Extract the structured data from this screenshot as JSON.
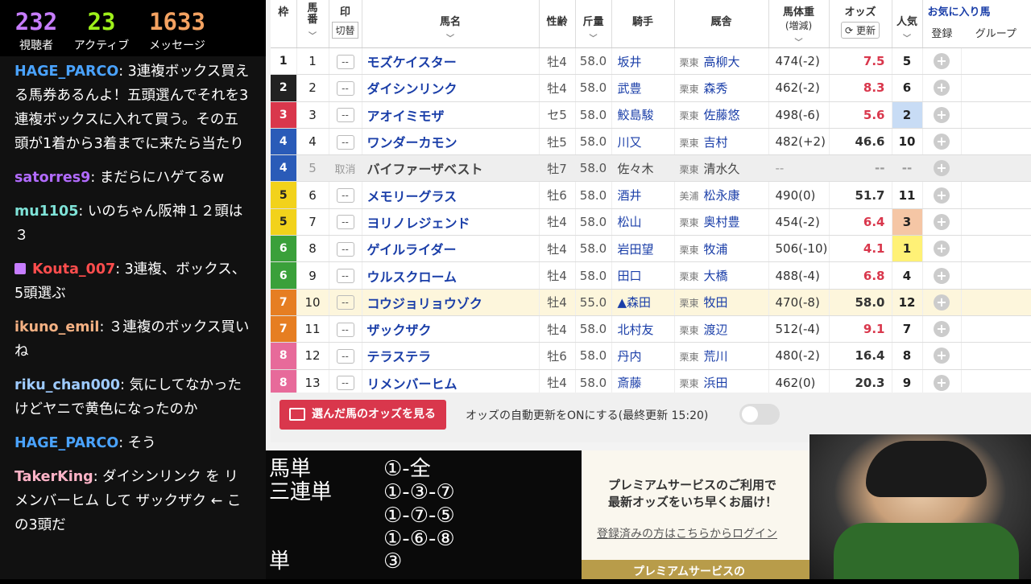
{
  "stats": [
    {
      "value": "232",
      "label": "視聴者",
      "color": "#c77dff"
    },
    {
      "value": "23",
      "label": "アクティブ",
      "color": "#9ef01a"
    },
    {
      "value": "1633",
      "label": "メッセージ",
      "color": "#f4a261"
    }
  ],
  "chat": [
    {
      "user": "HAGE_PARCO",
      "color": "#4aa3ff",
      "text": ": 3連複ボックス買える馬券あるんよ！五頭選んでそれを3連複ボックスに入れて買う。その五頭が1着から3着までに来たら当たり",
      "gift": false
    },
    {
      "user": "satorres9",
      "color": "#b26bff",
      "text": ": まだらにハゲてるw",
      "gift": false
    },
    {
      "user": "mu1105",
      "color": "#7fe3d8",
      "text": ": いのちゃん阪神１２頭は３",
      "gift": false
    },
    {
      "user": "Kouta_007",
      "color": "#ff4d4d",
      "text": ": 3連複、ボックス、5頭選ぶ",
      "gift": true
    },
    {
      "user": "ikuno_emil",
      "color": "#f4b183",
      "text": ": ３連複のボックス買いね",
      "gift": false
    },
    {
      "user": "riku_chan000",
      "color": "#9ecbff",
      "text": ": 気にしてなかったけどヤニで黄色になったのか",
      "gift": false
    },
    {
      "user": "HAGE_PARCO",
      "color": "#4aa3ff",
      "text": ": そう",
      "gift": false
    },
    {
      "user": "TakerKing",
      "color": "#ffb3c7",
      "text": ": ダイシンリンク を リメンバーヒム して ザックザク ← この3頭だ",
      "gift": false
    }
  ],
  "table": {
    "headers": {
      "waku": "枠",
      "umaban": "馬番",
      "mark": "印",
      "mark_btn": "切替",
      "name": "馬名",
      "age": "性齢",
      "kinryo": "斤量",
      "jockey": "騎手",
      "stable": "厩舎",
      "weight": "馬体重",
      "weight_sub": "(増減)",
      "odds": "オッズ",
      "odds_refresh": "更新",
      "ninki": "人気",
      "fav": "お気に入り馬",
      "fav_reg": "登録",
      "fav_group": "グループ"
    },
    "rows": [
      {
        "waku": "1",
        "umaban": "1",
        "mark": "--",
        "name": "モズケイスター",
        "age": "牡4",
        "kinryo": "58.0",
        "jockey": "坂井",
        "loc": "栗東",
        "trainer": "高柳大",
        "weight": "474(-2)",
        "odds": "7.5",
        "ninki": "5",
        "odds_color": "#d9374c",
        "ninki_bg": ""
      },
      {
        "waku": "2",
        "umaban": "2",
        "mark": "--",
        "name": "ダイシンリンク",
        "age": "牡4",
        "kinryo": "58.0",
        "jockey": "武豊",
        "loc": "栗東",
        "trainer": "森秀",
        "weight": "462(-2)",
        "odds": "8.3",
        "ninki": "6",
        "odds_color": "#d9374c",
        "ninki_bg": ""
      },
      {
        "waku": "3",
        "umaban": "3",
        "mark": "--",
        "name": "アオイミモザ",
        "age": "セ5",
        "kinryo": "58.0",
        "jockey": "鮫島駿",
        "loc": "栗東",
        "trainer": "佐藤悠",
        "weight": "498(-6)",
        "odds": "5.6",
        "ninki": "2",
        "odds_color": "#d9374c",
        "ninki_bg": "#c8dcf5"
      },
      {
        "waku": "4",
        "umaban": "4",
        "mark": "--",
        "name": "ワンダーカモン",
        "age": "牡5",
        "kinryo": "58.0",
        "jockey": "川又",
        "loc": "栗東",
        "trainer": "吉村",
        "weight": "482(+2)",
        "odds": "46.6",
        "ninki": "10",
        "odds_color": "#333",
        "ninki_bg": ""
      },
      {
        "waku": "4",
        "umaban": "5",
        "mark": "取消",
        "name": "バイファーザベスト",
        "age": "牡7",
        "kinryo": "58.0",
        "jockey": "佐々木",
        "loc": "栗東",
        "trainer": "清水久",
        "weight": "--",
        "odds": "--",
        "ninki": "--",
        "odds_color": "#999",
        "ninki_bg": "",
        "cancel": true
      },
      {
        "waku": "5",
        "umaban": "6",
        "mark": "--",
        "name": "メモリーグラス",
        "age": "牡6",
        "kinryo": "58.0",
        "jockey": "酒井",
        "loc": "美浦",
        "trainer": "松永康",
        "weight": "490(0)",
        "odds": "51.7",
        "ninki": "11",
        "odds_color": "#333",
        "ninki_bg": ""
      },
      {
        "waku": "5",
        "umaban": "7",
        "mark": "--",
        "name": "ヨリノレジェンド",
        "age": "牡4",
        "kinryo": "58.0",
        "jockey": "松山",
        "loc": "栗東",
        "trainer": "奥村豊",
        "weight": "454(-2)",
        "odds": "6.4",
        "ninki": "3",
        "odds_color": "#d9374c",
        "ninki_bg": "#f5c6a5"
      },
      {
        "waku": "6",
        "umaban": "8",
        "mark": "--",
        "name": "ゲイルライダー",
        "age": "牡4",
        "kinryo": "58.0",
        "jockey": "岩田望",
        "loc": "栗東",
        "trainer": "牧浦",
        "weight": "506(-10)",
        "odds": "4.1",
        "ninki": "1",
        "odds_color": "#d9374c",
        "ninki_bg": "#fff176"
      },
      {
        "waku": "6",
        "umaban": "9",
        "mark": "--",
        "name": "ウルスクローム",
        "age": "牡4",
        "kinryo": "58.0",
        "jockey": "田口",
        "loc": "栗東",
        "trainer": "大橋",
        "weight": "488(-4)",
        "odds": "6.8",
        "ninki": "4",
        "odds_color": "#d9374c",
        "ninki_bg": ""
      },
      {
        "waku": "7",
        "umaban": "10",
        "mark": "--",
        "name": "コウジョリョウゾク",
        "age": "牡4",
        "kinryo": "55.0",
        "jockey": "▲森田",
        "loc": "栗東",
        "trainer": "牧田",
        "weight": "470(-8)",
        "odds": "58.0",
        "ninki": "12",
        "odds_color": "#333",
        "ninki_bg": "",
        "hl": true
      },
      {
        "waku": "7",
        "umaban": "11",
        "mark": "--",
        "name": "ザックザク",
        "age": "牡4",
        "kinryo": "58.0",
        "jockey": "北村友",
        "loc": "栗東",
        "trainer": "渡辺",
        "weight": "512(-4)",
        "odds": "9.1",
        "ninki": "7",
        "odds_color": "#d9374c",
        "ninki_bg": ""
      },
      {
        "waku": "8",
        "umaban": "12",
        "mark": "--",
        "name": "テラステラ",
        "age": "牡6",
        "kinryo": "58.0",
        "jockey": "丹内",
        "loc": "栗東",
        "trainer": "荒川",
        "weight": "480(-2)",
        "odds": "16.4",
        "ninki": "8",
        "odds_color": "#333",
        "ninki_bg": ""
      },
      {
        "waku": "8",
        "umaban": "13",
        "mark": "--",
        "name": "リメンバーヒム",
        "age": "牡4",
        "kinryo": "58.0",
        "jockey": "斎藤",
        "loc": "栗東",
        "trainer": "浜田",
        "weight": "462(0)",
        "odds": "20.3",
        "ninki": "9",
        "odds_color": "#333",
        "ninki_bg": ""
      }
    ]
  },
  "waku_colors": {
    "1": "#ffffff",
    "2": "#222222",
    "3": "#d9374c",
    "4": "#2a5bb8",
    "5": "#f2d21b",
    "6": "#3aa03a",
    "7": "#e67e22",
    "8": "#e76a9a"
  },
  "bottom": {
    "odds_button": "選んだ馬のオッズを見る",
    "auto_update": "オッズの自動更新をONにする(最終更新 15:20)"
  },
  "notes": [
    {
      "label": "馬単",
      "combo": "①-全"
    },
    {
      "label": "三連単",
      "combo": "①-③-⑦"
    },
    {
      "label": "",
      "combo": "①-⑦-⑤"
    },
    {
      "label": "",
      "combo": "①-⑥-⑧"
    },
    {
      "label": "単",
      "combo": "③"
    }
  ],
  "premium": {
    "line1": "プレミアムサービスのご利用で",
    "line2": "最新オッズをいち早くお届け！",
    "link": "登録済みの方はこちらからログイン",
    "bar": "プレミアムサービスの"
  }
}
